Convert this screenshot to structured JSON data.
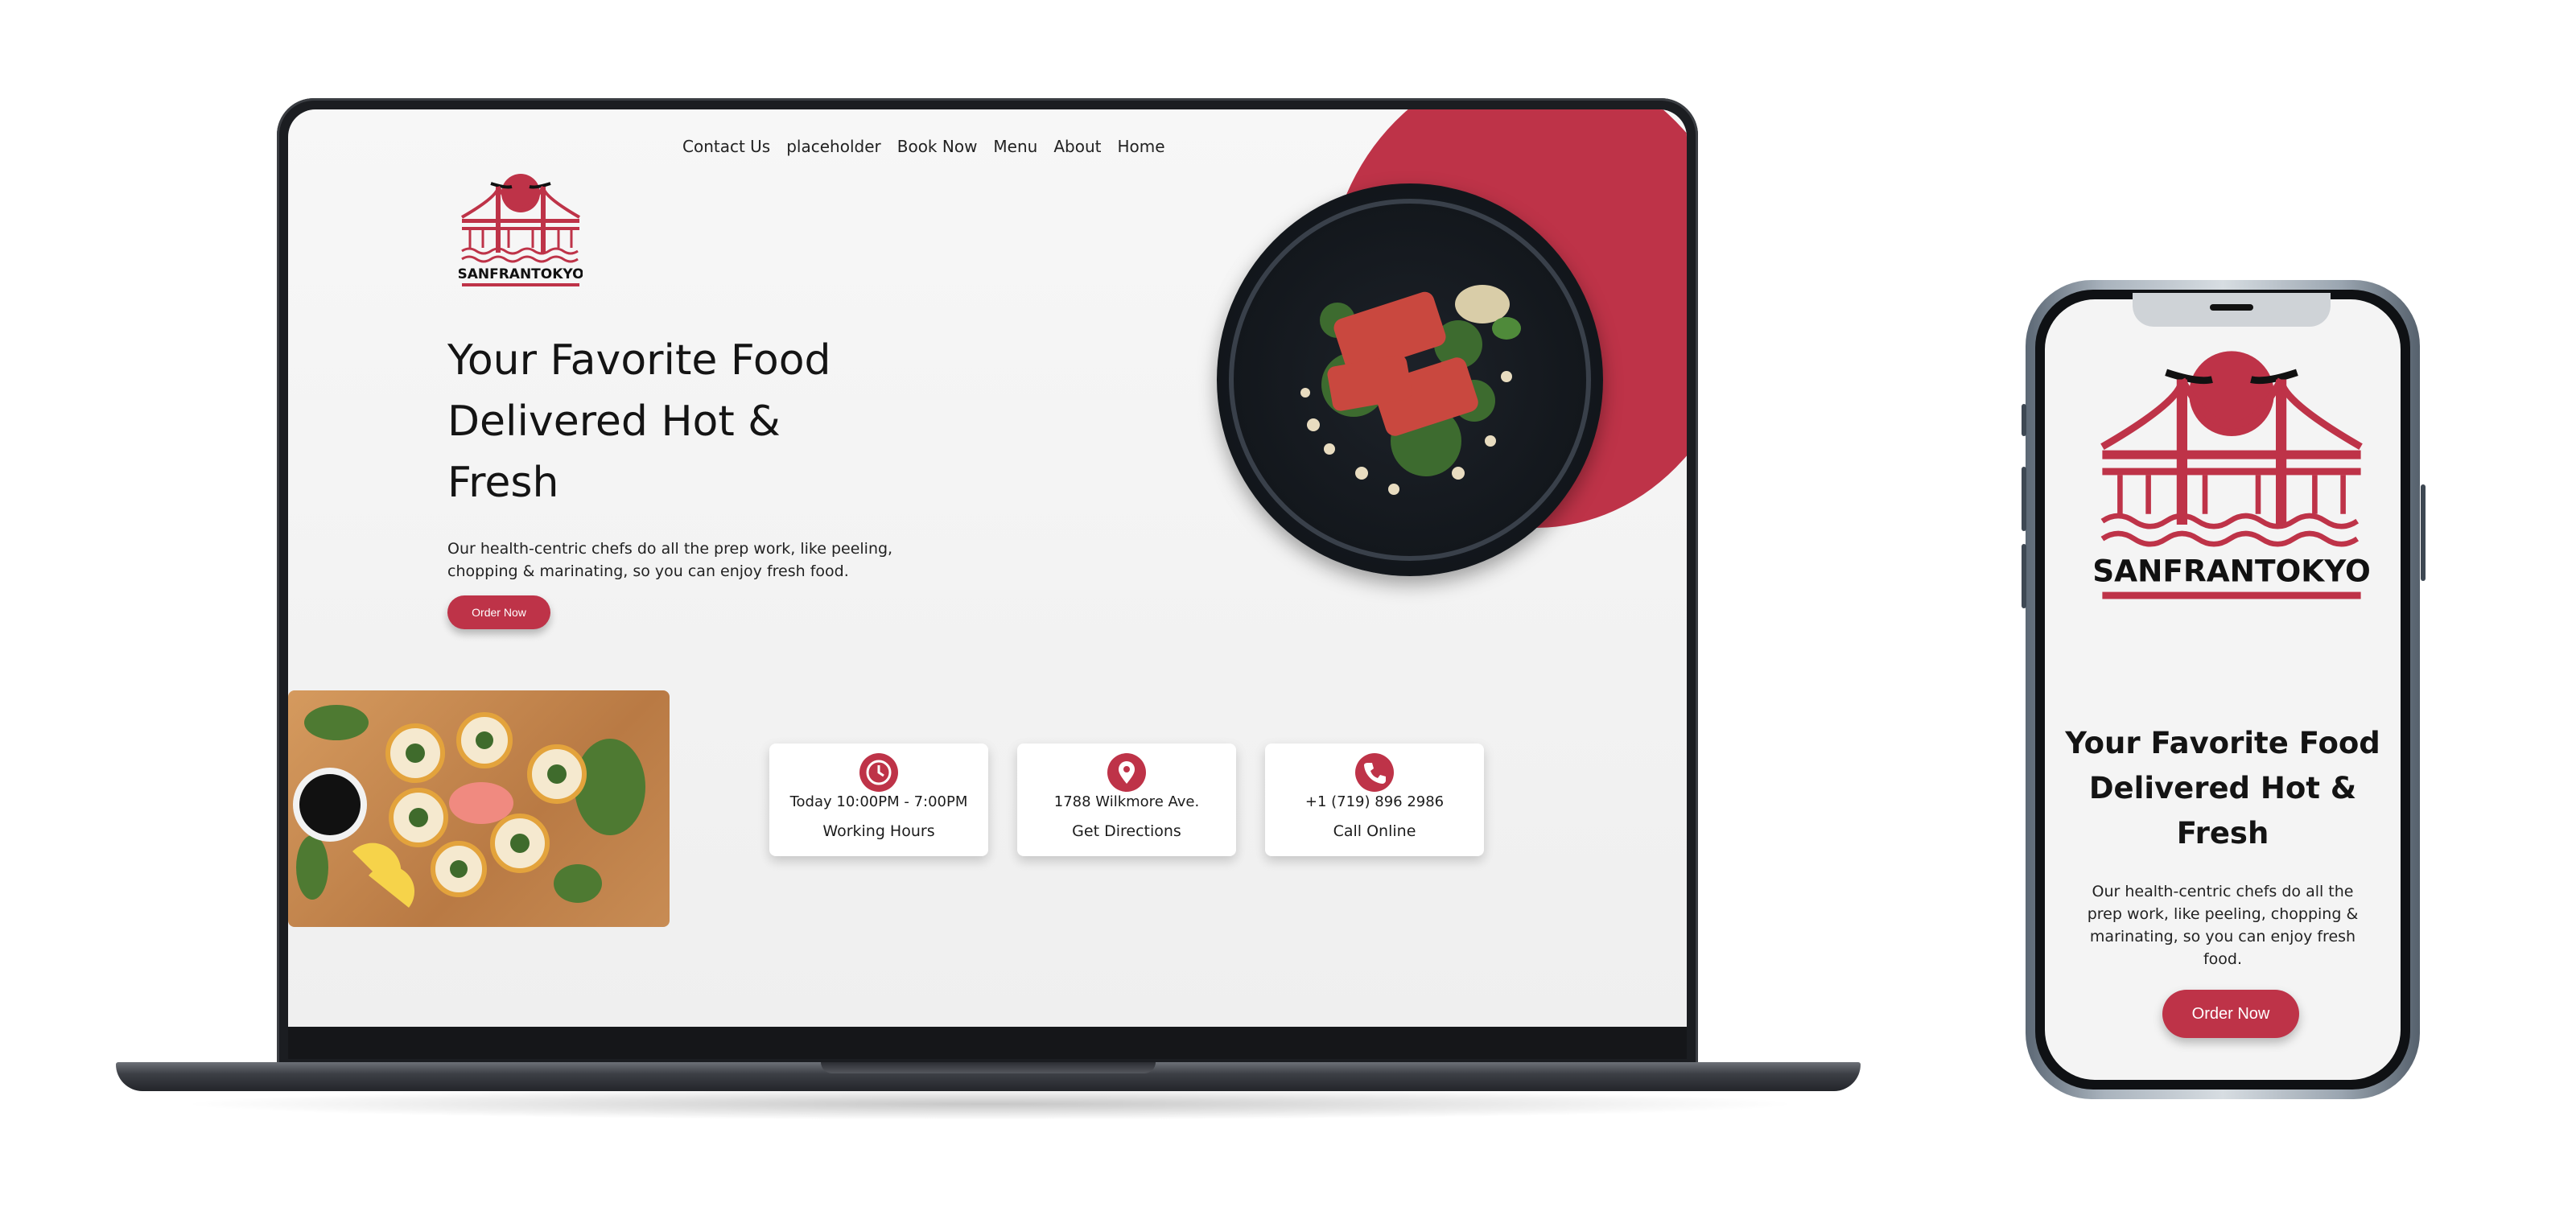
{
  "desktop": {
    "nav": [
      "Contact Us",
      "placeholder",
      "Book Now",
      "Menu",
      "About",
      "Home"
    ],
    "logo_text": "SANFRANTOKYO",
    "hero_title": "Your Favorite Food Delivered Hot & Fresh",
    "hero_text": "Our health-centric chefs do all the prep work, like peeling, chopping & marinating, so you can enjoy fresh food.",
    "order_button": "Order Now",
    "cards": [
      {
        "icon": "clock-icon",
        "line1": "Today 10:00PM - 7:00PM",
        "line2": "Working Hours"
      },
      {
        "icon": "location-pin-icon",
        "line1": "1788 Wilkmore Ave.",
        "line2": "Get Directions"
      },
      {
        "icon": "phone-icon",
        "line1": "+1 (719) 896 2986",
        "line2": "Call Online"
      }
    ]
  },
  "mobile": {
    "logo_text": "SANFRANTOKYO",
    "hero_title": "Your Favorite Food Delivered Hot & Fresh",
    "hero_text": "Our health-centric chefs do all the prep work, like peeling, chopping & marinating, so you can enjoy fresh food.",
    "order_button": "Order Now"
  },
  "colors": {
    "brand_red": "#be3348",
    "text": "#141414",
    "background": "#f4f4f4"
  }
}
